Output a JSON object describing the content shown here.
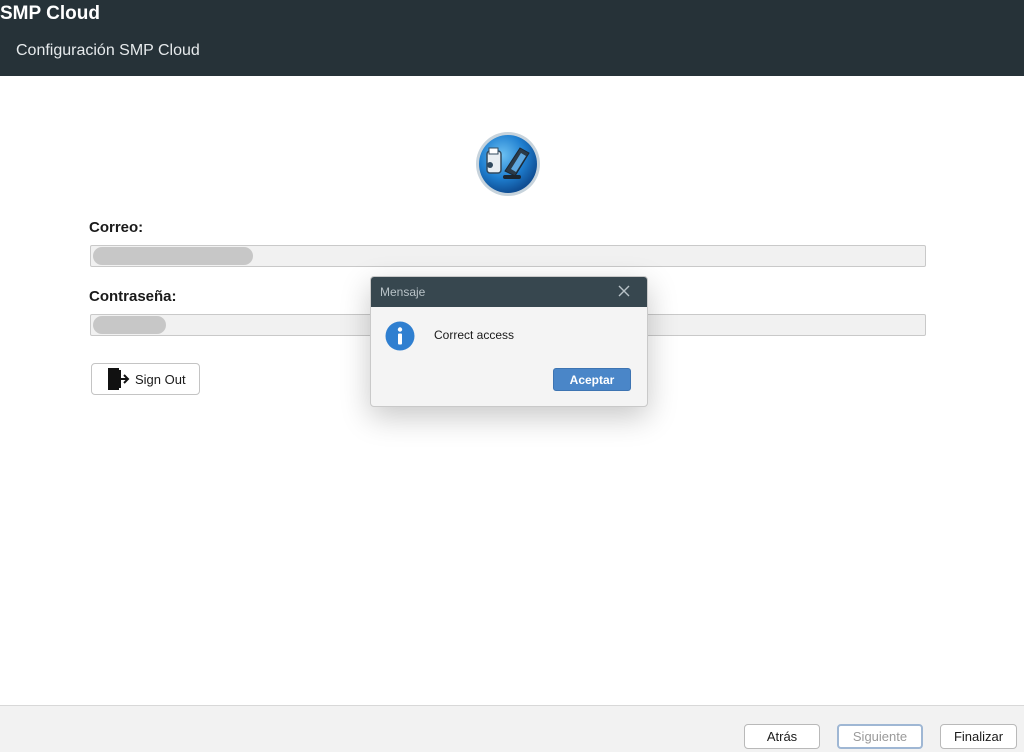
{
  "app": {
    "title": "SMP Cloud",
    "subtitle": "Configuración SMP Cloud"
  },
  "form": {
    "email_label": "Correo:",
    "email_value": "",
    "password_label": "Contraseña:",
    "password_value": "",
    "signout_label": "Sign Out"
  },
  "footer": {
    "back_label": "Atrás",
    "next_label": "Siguiente",
    "finish_label": "Finalizar"
  },
  "dialog": {
    "title": "Mensaje",
    "message": "Correct access",
    "accept_label": "Aceptar"
  },
  "colors": {
    "header_bg": "#263238",
    "dialog_titlebar": "#37474f",
    "accent": "#4a86c8",
    "footer_bg": "#f2f2f2"
  },
  "icons": {
    "logo": "pos-terminal-logo-icon",
    "signout": "exit-door-icon",
    "info": "info-icon",
    "close": "close-icon"
  }
}
